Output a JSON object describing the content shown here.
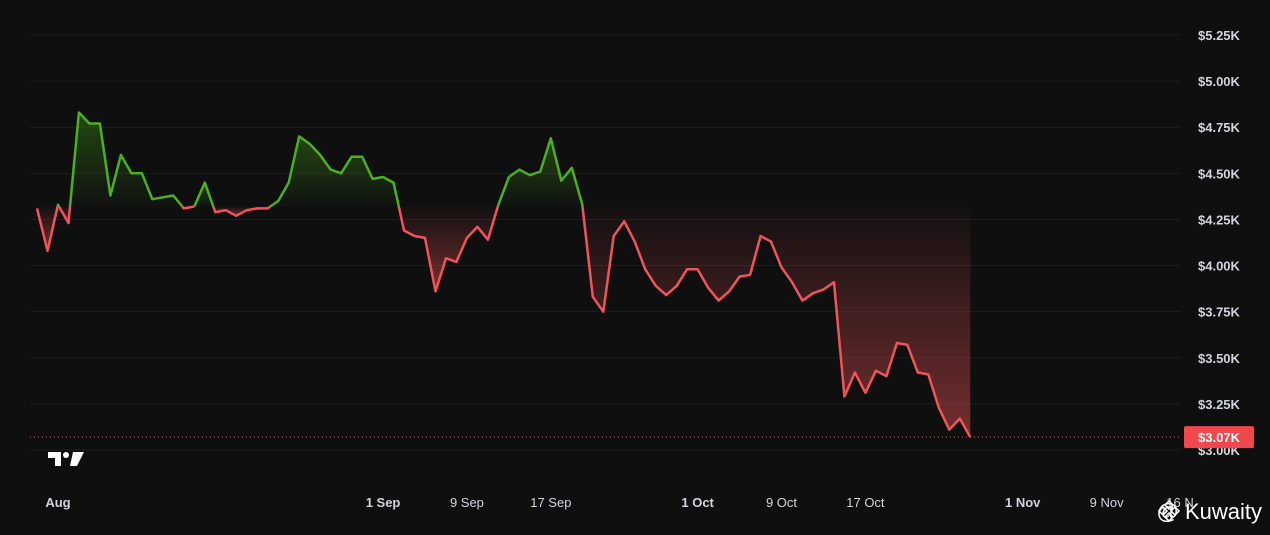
{
  "watermark": {
    "text": "@ Kuwaity",
    "icon": "binance-logo-icon"
  },
  "logo": {
    "icon": "tradingview-logo-icon"
  },
  "colors": {
    "background": "#0f0f0f",
    "up": "#4caf1e",
    "down": "#f05459",
    "grid": "#1e1e1e",
    "label_bg": "#f0484d"
  },
  "chart_data": {
    "type": "line",
    "baseline_style": true,
    "baseline_value": 4320,
    "last_value": 3070,
    "last_value_label": "$3.07K",
    "x_domain": [
      "2024-07-30",
      "2024-11-16"
    ],
    "ylim": [
      3000,
      5250
    ],
    "yticks": [
      {
        "value": 5250,
        "label": "$5.25K"
      },
      {
        "value": 5000,
        "label": "$5.00K"
      },
      {
        "value": 4750,
        "label": "$4.75K"
      },
      {
        "value": 4500,
        "label": "$4.50K"
      },
      {
        "value": 4250,
        "label": "$4.25K"
      },
      {
        "value": 4000,
        "label": "$4.00K"
      },
      {
        "value": 3750,
        "label": "$3.75K"
      },
      {
        "value": 3500,
        "label": "$3.50K"
      },
      {
        "value": 3250,
        "label": "$3.25K"
      },
      {
        "value": 3000,
        "label": "$3.00K"
      }
    ],
    "xticks": [
      {
        "date": "2024-08-01",
        "label": "Aug",
        "major": true
      },
      {
        "date": "2024-09-01",
        "label": "1 Sep",
        "major": true
      },
      {
        "date": "2024-09-09",
        "label": "9 Sep",
        "major": false
      },
      {
        "date": "2024-09-17",
        "label": "17 Sep",
        "major": false
      },
      {
        "date": "2024-10-01",
        "label": "1 Oct",
        "major": true
      },
      {
        "date": "2024-10-09",
        "label": "9 Oct",
        "major": false
      },
      {
        "date": "2024-10-17",
        "label": "17 Oct",
        "major": false
      },
      {
        "date": "2024-11-01",
        "label": "1 Nov",
        "major": true
      },
      {
        "date": "2024-11-09",
        "label": "9 Nov",
        "major": false
      },
      {
        "date": "2024-11-16",
        "label": "16 N",
        "major": false
      }
    ],
    "series": [
      {
        "points": [
          [
            "2024-07-30",
            4310
          ],
          [
            "2024-07-31",
            4080
          ],
          [
            "2024-08-01",
            4330
          ],
          [
            "2024-08-02",
            4230
          ],
          [
            "2024-08-03",
            4830
          ],
          [
            "2024-08-04",
            4770
          ],
          [
            "2024-08-05",
            4770
          ],
          [
            "2024-08-06",
            4380
          ],
          [
            "2024-08-07",
            4600
          ],
          [
            "2024-08-08",
            4500
          ],
          [
            "2024-08-09",
            4500
          ],
          [
            "2024-08-10",
            4360
          ],
          [
            "2024-08-11",
            4370
          ],
          [
            "2024-08-12",
            4380
          ],
          [
            "2024-08-13",
            4310
          ],
          [
            "2024-08-14",
            4320
          ],
          [
            "2024-08-15",
            4450
          ],
          [
            "2024-08-16",
            4290
          ],
          [
            "2024-08-17",
            4300
          ],
          [
            "2024-08-18",
            4270
          ],
          [
            "2024-08-19",
            4300
          ],
          [
            "2024-08-20",
            4310
          ],
          [
            "2024-08-21",
            4310
          ],
          [
            "2024-08-22",
            4350
          ],
          [
            "2024-08-23",
            4450
          ],
          [
            "2024-08-24",
            4700
          ],
          [
            "2024-08-25",
            4660
          ],
          [
            "2024-08-26",
            4600
          ],
          [
            "2024-08-27",
            4520
          ],
          [
            "2024-08-28",
            4500
          ],
          [
            "2024-08-29",
            4590
          ],
          [
            "2024-08-30",
            4590
          ],
          [
            "2024-08-31",
            4470
          ],
          [
            "2024-09-01",
            4480
          ],
          [
            "2024-09-02",
            4450
          ],
          [
            "2024-09-03",
            4190
          ],
          [
            "2024-09-04",
            4160
          ],
          [
            "2024-09-05",
            4150
          ],
          [
            "2024-09-06",
            3860
          ],
          [
            "2024-09-07",
            4040
          ],
          [
            "2024-09-08",
            4020
          ],
          [
            "2024-09-09",
            4150
          ],
          [
            "2024-09-10",
            4210
          ],
          [
            "2024-09-11",
            4140
          ],
          [
            "2024-09-12",
            4330
          ],
          [
            "2024-09-13",
            4480
          ],
          [
            "2024-09-14",
            4520
          ],
          [
            "2024-09-15",
            4490
          ],
          [
            "2024-09-16",
            4510
          ],
          [
            "2024-09-17",
            4690
          ],
          [
            "2024-09-18",
            4460
          ],
          [
            "2024-09-19",
            4530
          ],
          [
            "2024-09-20",
            4330
          ],
          [
            "2024-09-21",
            3830
          ],
          [
            "2024-09-22",
            3750
          ],
          [
            "2024-09-23",
            4160
          ],
          [
            "2024-09-24",
            4240
          ],
          [
            "2024-09-25",
            4130
          ],
          [
            "2024-09-26",
            3980
          ],
          [
            "2024-09-27",
            3890
          ],
          [
            "2024-09-28",
            3840
          ],
          [
            "2024-09-29",
            3890
          ],
          [
            "2024-09-30",
            3980
          ],
          [
            "2024-10-01",
            3980
          ],
          [
            "2024-10-02",
            3880
          ],
          [
            "2024-10-03",
            3810
          ],
          [
            "2024-10-04",
            3860
          ],
          [
            "2024-10-05",
            3940
          ],
          [
            "2024-10-06",
            3950
          ],
          [
            "2024-10-07",
            4160
          ],
          [
            "2024-10-08",
            4130
          ],
          [
            "2024-10-09",
            3990
          ],
          [
            "2024-10-10",
            3910
          ],
          [
            "2024-10-11",
            3810
          ],
          [
            "2024-10-12",
            3850
          ],
          [
            "2024-10-13",
            3870
          ],
          [
            "2024-10-14",
            3910
          ],
          [
            "2024-10-15",
            3290
          ],
          [
            "2024-10-16",
            3420
          ],
          [
            "2024-10-17",
            3310
          ],
          [
            "2024-10-18",
            3430
          ],
          [
            "2024-10-19",
            3400
          ],
          [
            "2024-10-20",
            3580
          ],
          [
            "2024-10-21",
            3570
          ],
          [
            "2024-10-22",
            3420
          ],
          [
            "2024-10-23",
            3410
          ],
          [
            "2024-10-24",
            3230
          ],
          [
            "2024-10-25",
            3110
          ],
          [
            "2024-10-26",
            3170
          ],
          [
            "2024-10-27",
            3070
          ]
        ]
      }
    ]
  }
}
